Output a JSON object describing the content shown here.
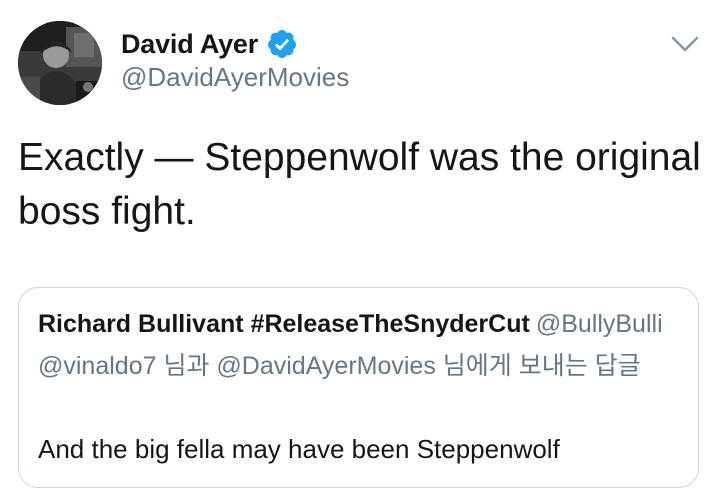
{
  "tweet": {
    "author": {
      "display_name": "David Ayer",
      "handle": "@DavidAyerMovies",
      "verified": true
    },
    "text": "Exactly — Steppenwolf was the original boss fight."
  },
  "quoted_tweet": {
    "display_name": "Richard Bullivant #ReleaseTheSnyderCut",
    "handle": "@BullyBulli",
    "reply_context": "@vinaldo7 님과 @DavidAyerMovies 님에게 보내는 답글",
    "text": "And the big fella may have been Steppenwolf"
  },
  "colors": {
    "verified_blue": "#1da1f2",
    "secondary_text": "#657786",
    "primary_text": "#14171a",
    "border": "#ccd6dd"
  },
  "icons": {
    "verified": "verified-badge-icon",
    "menu": "chevron-down-icon"
  }
}
